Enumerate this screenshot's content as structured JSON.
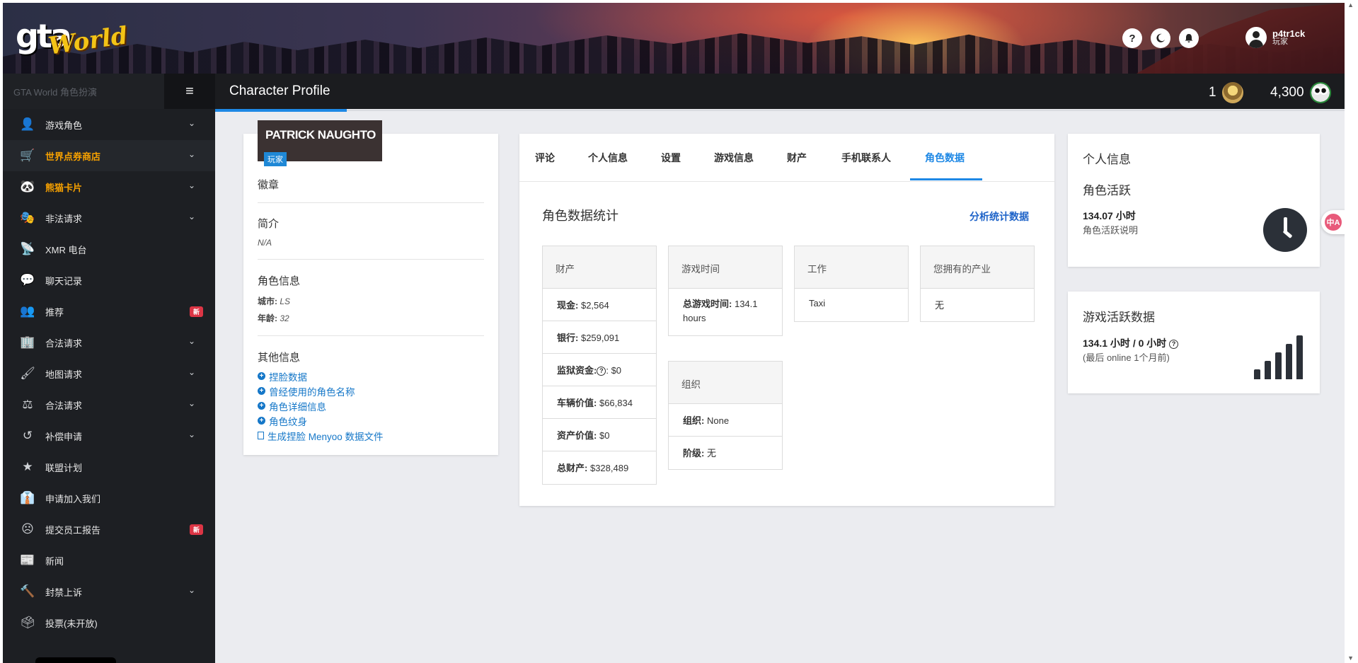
{
  "logo": {
    "gta": "gta",
    "world": "World"
  },
  "header": {
    "icons": [
      "help-icon",
      "moon-icon",
      "bell-icon"
    ],
    "help_glyph": "?",
    "username": "p4tr1ck",
    "user_role": "玩家"
  },
  "sidebar": {
    "title": "GTA World 角色扮演",
    "toggle_glyph": "≡",
    "items": [
      {
        "label": "游戏角色",
        "icon": "user-icon",
        "glyph": "👤",
        "chevron": true
      },
      {
        "label": "世界点券商店",
        "icon": "cart-icon",
        "glyph": "🛒",
        "chevron": true
      },
      {
        "label": "熊猫卡片",
        "icon": "panda-icon",
        "glyph": "🐼",
        "chevron": true
      },
      {
        "label": "非法请求",
        "icon": "mask-icon",
        "glyph": "🎭",
        "chevron": true
      },
      {
        "label": "XMR 电台",
        "icon": "radio-tower-icon",
        "glyph": "📡",
        "chevron": false
      },
      {
        "label": "聊天记录",
        "icon": "chat-icon",
        "glyph": "💬",
        "chevron": false
      },
      {
        "label": "推荐",
        "icon": "users-icon",
        "glyph": "👥",
        "badge": "新"
      },
      {
        "label": "合法请求",
        "icon": "building-icon",
        "glyph": "🏢",
        "chevron": true
      },
      {
        "label": "地图请求",
        "icon": "brush-icon",
        "glyph": "🖌",
        "chevron": true
      },
      {
        "label": "合法请求",
        "icon": "scale-icon",
        "glyph": "⚖",
        "chevron": true
      },
      {
        "label": "补偿申请",
        "icon": "undo-icon",
        "glyph": "↺",
        "chevron": true
      },
      {
        "label": "联盟计划",
        "icon": "star-icon",
        "glyph": "★",
        "chevron": false
      },
      {
        "label": "申请加入我们",
        "icon": "user-tie-icon",
        "glyph": "👔",
        "chevron": false
      },
      {
        "label": "提交员工报告",
        "icon": "face-icon",
        "glyph": "☹",
        "badge": "新"
      },
      {
        "label": "新闻",
        "icon": "newspaper-icon",
        "glyph": "📰",
        "chevron": false
      },
      {
        "label": "封禁上诉",
        "icon": "gavel-icon",
        "glyph": "🔨",
        "chevron": true
      },
      {
        "label": "投票(未开放)",
        "icon": "vote-icon",
        "glyph": "🗳",
        "chevron": false
      }
    ]
  },
  "titlebar": {
    "title": "Character Profile",
    "medal_count": "1",
    "coins": "4,300"
  },
  "profile": {
    "name": "PATRICK NAUGHTO",
    "role": "玩家",
    "badges_heading": "徽章",
    "bio_heading": "简介",
    "bio_value": "N/A",
    "char_info_heading": "角色信息",
    "city_label": "城市:",
    "city_value": "LS",
    "age_label": "年龄:",
    "age_value": "32",
    "other_heading": "其他信息",
    "links": [
      "捏脸数据",
      "曾经使用的角色名称",
      "角色详细信息",
      "角色纹身"
    ],
    "menyoo_link": "生成捏脸 Menyoo 数据文件"
  },
  "tabs": [
    "评论",
    "个人信息",
    "设置",
    "游戏信息",
    "财产",
    "手机联系人",
    "角色数据"
  ],
  "active_tab": "角色数据",
  "stats": {
    "title": "角色数据统计",
    "analyze_link": "分析统计数据",
    "property": {
      "heading": "财产",
      "rows": [
        {
          "label": "现金:",
          "value": "$2,564"
        },
        {
          "label": "银行:",
          "value": "$259,091"
        },
        {
          "label": "监狱资金:",
          "value": "$0",
          "help": true
        },
        {
          "label": "车辆价值:",
          "value": "$66,834"
        },
        {
          "label": "资产价值:",
          "value": "$0"
        },
        {
          "label": "总财产:",
          "value": "$328,489"
        }
      ]
    },
    "playtime": {
      "heading": "游戏时间",
      "label": "总游戏时间:",
      "value": "134.1 hours"
    },
    "job": {
      "heading": "工作",
      "value": "Taxi"
    },
    "owned": {
      "heading": "您拥有的产业",
      "value": "无"
    },
    "org": {
      "heading": "组织",
      "org_label": "组织:",
      "org_value": "None",
      "rank_label": "阶级:",
      "rank_value": "无"
    }
  },
  "right": {
    "info_title": "个人信息",
    "activity_title": "角色活跃",
    "activity_hours": "134.07 小时",
    "activity_desc": "角色活跃说明",
    "game_title": "游戏活跃数据",
    "game_hours": "134.1 小时 / 0 小时",
    "game_last": "(最后 online 1个月前)"
  },
  "translate_glyph": "中A"
}
